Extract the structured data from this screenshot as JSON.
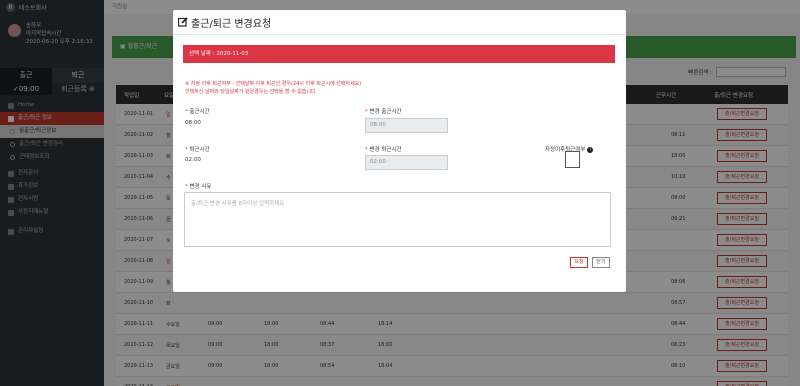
{
  "sidebar": {
    "brand": "테스트회사",
    "user": {
      "name": "송하우",
      "last_login_label": "마지막접속시간",
      "last_login": "2020-06-20 오후 2:16:33"
    },
    "tabs": [
      "출근",
      "퇴근"
    ],
    "clock_time": "09:00",
    "clock_out_register": "퇴근등록",
    "menu": [
      {
        "label": "Home",
        "active": false
      },
      {
        "label": "출근/퇴근 정보",
        "active": true
      }
    ],
    "submenu": [
      {
        "label": "월출근/퇴근정보",
        "selected": true
      },
      {
        "label": "출근/퇴근 변경관리",
        "selected": false
      },
      {
        "label": "근태정보조회",
        "selected": false
      }
    ],
    "menu2": [
      "전자문서",
      "휴가정보",
      "전자서명",
      "사원지매뉴얼"
    ],
    "admin": "관리자설정"
  },
  "main": {
    "breadcrumb": "직원월",
    "green_title": "월출근/퇴근",
    "search_label": "빠른검색 :",
    "table": {
      "headers": [
        "작업일",
        "요일",
        "근무시간",
        "출/퇴근 변경요청"
      ],
      "rows": [
        {
          "date": "2020-11-01",
          "day": "일",
          "c1": "",
          "c2": "",
          "c3": "",
          "c4": "",
          "end": "",
          "req": "출/퇴근변경요청"
        },
        {
          "date": "2020-11-02",
          "day": "월",
          "c1": "",
          "c2": "",
          "c3": "",
          "c4": "",
          "end": "08:11",
          "req": "출/퇴근변경요청"
        },
        {
          "date": "2020-11-03",
          "day": "화",
          "c1": "",
          "c2": "",
          "c3": "",
          "c4": "",
          "end": "18:00",
          "req": "출/퇴근변경요청"
        },
        {
          "date": "2020-11-04",
          "day": "수",
          "c1": "",
          "c2": "",
          "c3": "",
          "c4": "",
          "end": "10:10",
          "req": "출/퇴근변경요청"
        },
        {
          "date": "2020-11-05",
          "day": "목",
          "c1": "",
          "c2": "",
          "c3": "",
          "c4": "",
          "end": "09:00",
          "req": "출/퇴근변경요청"
        },
        {
          "date": "2020-11-06",
          "day": "금",
          "c1": "",
          "c2": "",
          "c3": "",
          "c4": "",
          "end": "09:21",
          "req": "출/퇴근변경요청"
        },
        {
          "date": "2020-11-07",
          "day": "토",
          "c1": "",
          "c2": "",
          "c3": "",
          "c4": "",
          "end": "",
          "req": "출/퇴근변경요청"
        },
        {
          "date": "2020-11-08",
          "day": "일",
          "c1": "",
          "c2": "",
          "c3": "",
          "c4": "",
          "end": "",
          "req": "출/퇴근변경요청"
        },
        {
          "date": "2020-11-09",
          "day": "월",
          "c1": "",
          "c2": "",
          "c3": "",
          "c4": "",
          "end": "08:06",
          "req": "출/퇴근변경요청"
        },
        {
          "date": "2020-11-10",
          "day": "화",
          "c1": "",
          "c2": "",
          "c3": "",
          "c4": "",
          "end": "08:57",
          "req": "출/퇴근변경요청"
        },
        {
          "date": "2020-11-11",
          "day": "수요일",
          "c1": "09:00",
          "c2": "18:00",
          "c3": "08:44",
          "c4": "18:14",
          "end": "08:44",
          "req": "출/퇴근변경요청"
        },
        {
          "date": "2020-11-12",
          "day": "목요일",
          "c1": "09:00",
          "c2": "18:00",
          "c3": "08:37",
          "c4": "18:00",
          "end": "08:23",
          "req": "출/퇴근변경요청"
        },
        {
          "date": "2020-11-13",
          "day": "금요일",
          "c1": "09:00",
          "c2": "18:00",
          "c3": "08:54",
          "c4": "18:04",
          "end": "08:10",
          "req": "출/퇴근변경요청"
        },
        {
          "date": "2020-11-14",
          "day": "토요일",
          "c1": "",
          "c2": "",
          "c3": "",
          "c4": "",
          "end": "",
          "req": "출/퇴근변경요청"
        }
      ]
    }
  },
  "modal": {
    "title": "출근/퇴근 변경요청",
    "date_bar": "선택 날짜 : 2020-11-03",
    "notice_line1": "※ 자정 이후 퇴근여부 : 선택날짜 이후 퇴근인 경우(24시 이후 퇴근시에 선택하세요)",
    "notice_line2": "선택하신 날짜와 당일날짜가 같은경우는 선택을 할 수 없습니다",
    "in_label": "출근시간",
    "in_value": "08:00",
    "change_in_label": "변경 출근시간",
    "change_in_value": "08:00",
    "out_label": "퇴근시간",
    "out_value": "02:00",
    "change_out_label": "변경 퇴근시간",
    "change_out_value": "02:00",
    "midnight_label": "자정이후퇴근여부",
    "reason_label": "변경 사유",
    "reason_placeholder": "출/퇴근 변경 사유를 8자이상 입력하세요",
    "submit_label": "요청",
    "close_label": "닫기"
  },
  "colors": {
    "danger": "#dc3545",
    "green": "#49a24d",
    "sidebar": "#2f3338"
  }
}
